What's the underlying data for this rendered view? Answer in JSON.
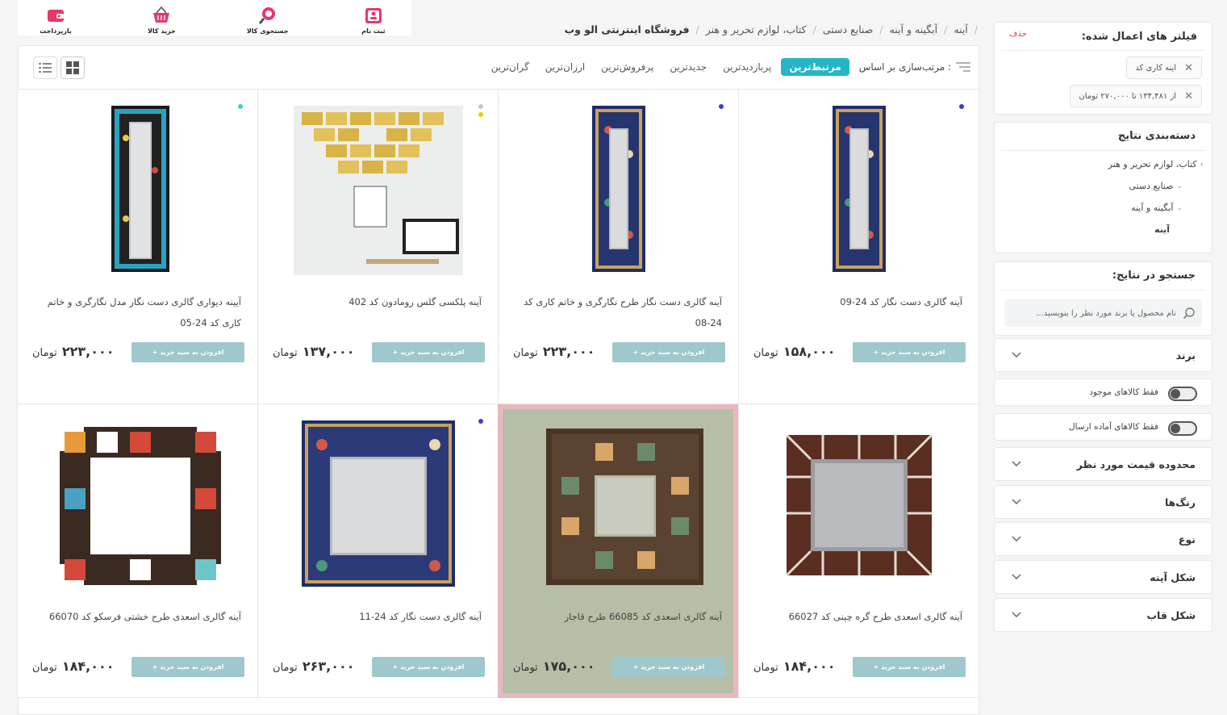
{
  "topnav": [
    {
      "label": "ثبت نام",
      "icon": "user-card-icon"
    },
    {
      "label": "جستجوی کالا",
      "icon": "search-icon"
    },
    {
      "label": "خرید کالا",
      "icon": "basket-icon"
    },
    {
      "label": "بازپرداخت",
      "icon": "wallet-icon"
    }
  ],
  "breadcrumb": {
    "store": "فروشگاه اینترنتی الو وب",
    "items": [
      "کتاب، لوازم تحریر و هنر",
      "صنایع دستی",
      "آبگینه و آینه",
      "آینه"
    ]
  },
  "sort": {
    "title": "مرتب‌سازی بر اساس :",
    "options": [
      "مرتبط‌ترین",
      "پربازدیدترین",
      "جدیدترین",
      "پرفروش‌ترین",
      "ارزان‌ترین",
      "گران‌ترین"
    ],
    "active_index": 0
  },
  "add_to_cart_label": "افزودن به سبد خرید +",
  "currency": "تومان",
  "products": [
    {
      "title": "آینه گالری دست نگار کد 24-09",
      "price": "۱۵۸,۰۰۰",
      "dots": [
        "#3a3adb"
      ],
      "art": "enamel-tall"
    },
    {
      "title": "آینه گالری دست نگار طرح نگارگری و خاتم کاری کد 24-08",
      "price": "۲۲۳,۰۰۰",
      "dots": [
        "#3a3adb"
      ],
      "art": "enamel-tall"
    },
    {
      "title": "آینه پلکسی گلس رومادون کد 402",
      "price": "۱۳۷,۰۰۰",
      "dots": [
        "#c8c8c8",
        "#e5d000"
      ],
      "art": "gold-bricks"
    },
    {
      "title": "آیینه دیواری گالری دست نگار مدل نگارگری و خاتم کاری کد 24-05",
      "price": "۲۲۳,۰۰۰",
      "dots": [
        "#3ad0d6"
      ],
      "art": "khatam-tall"
    },
    {
      "title": "آینه گالری اسعدی طرح گره چینی کد 66027",
      "price": "۱۸۴,۰۰۰",
      "dots": [],
      "art": "lattice"
    },
    {
      "title": "آینه گالری اسعدی کد 66085 طرح قاجار",
      "price": "۱۷۵,۰۰۰",
      "dots": [],
      "art": "tile-frame"
    },
    {
      "title": "آینه گالری دست نگار کد 24-11",
      "price": "۲۶۳,۰۰۰",
      "dots": [
        "#3a3adb"
      ],
      "art": "enamel-wide"
    },
    {
      "title": "آینه گالری اسعدی طرح خشتی فرسکو کد 66070",
      "price": "۱۸۴,۰۰۰",
      "dots": [],
      "art": "tile-cross"
    }
  ],
  "sidebar": {
    "filters": {
      "title": "فیلتر های اعمال شده:",
      "remove": "حذف",
      "chips": [
        "اینه کاری کد",
        "از ۱۳۴,۴۸۱ تا ۲۷۰,۰۰۰ تومان"
      ]
    },
    "categories": {
      "title": "دسته‌بندی نتایج",
      "items": [
        "کتاب، لوازم تحریر و هنر",
        "صنایع دستی",
        "آبگینه و آینه",
        "آینه"
      ]
    },
    "search": {
      "title": "جستجو در نتایج:",
      "placeholder": "نام محصول یا برند مورد نظر را بنویسید..."
    },
    "brand": "برند",
    "toggles": [
      "فقط کالاهای موجود",
      "فقط کالاهای آماده ارسال"
    ],
    "accordions": [
      "محدوده قیمت مورد نظر",
      "رنگ‌ها",
      "نوع",
      "شکل آینه",
      "شکل قاب"
    ]
  }
}
